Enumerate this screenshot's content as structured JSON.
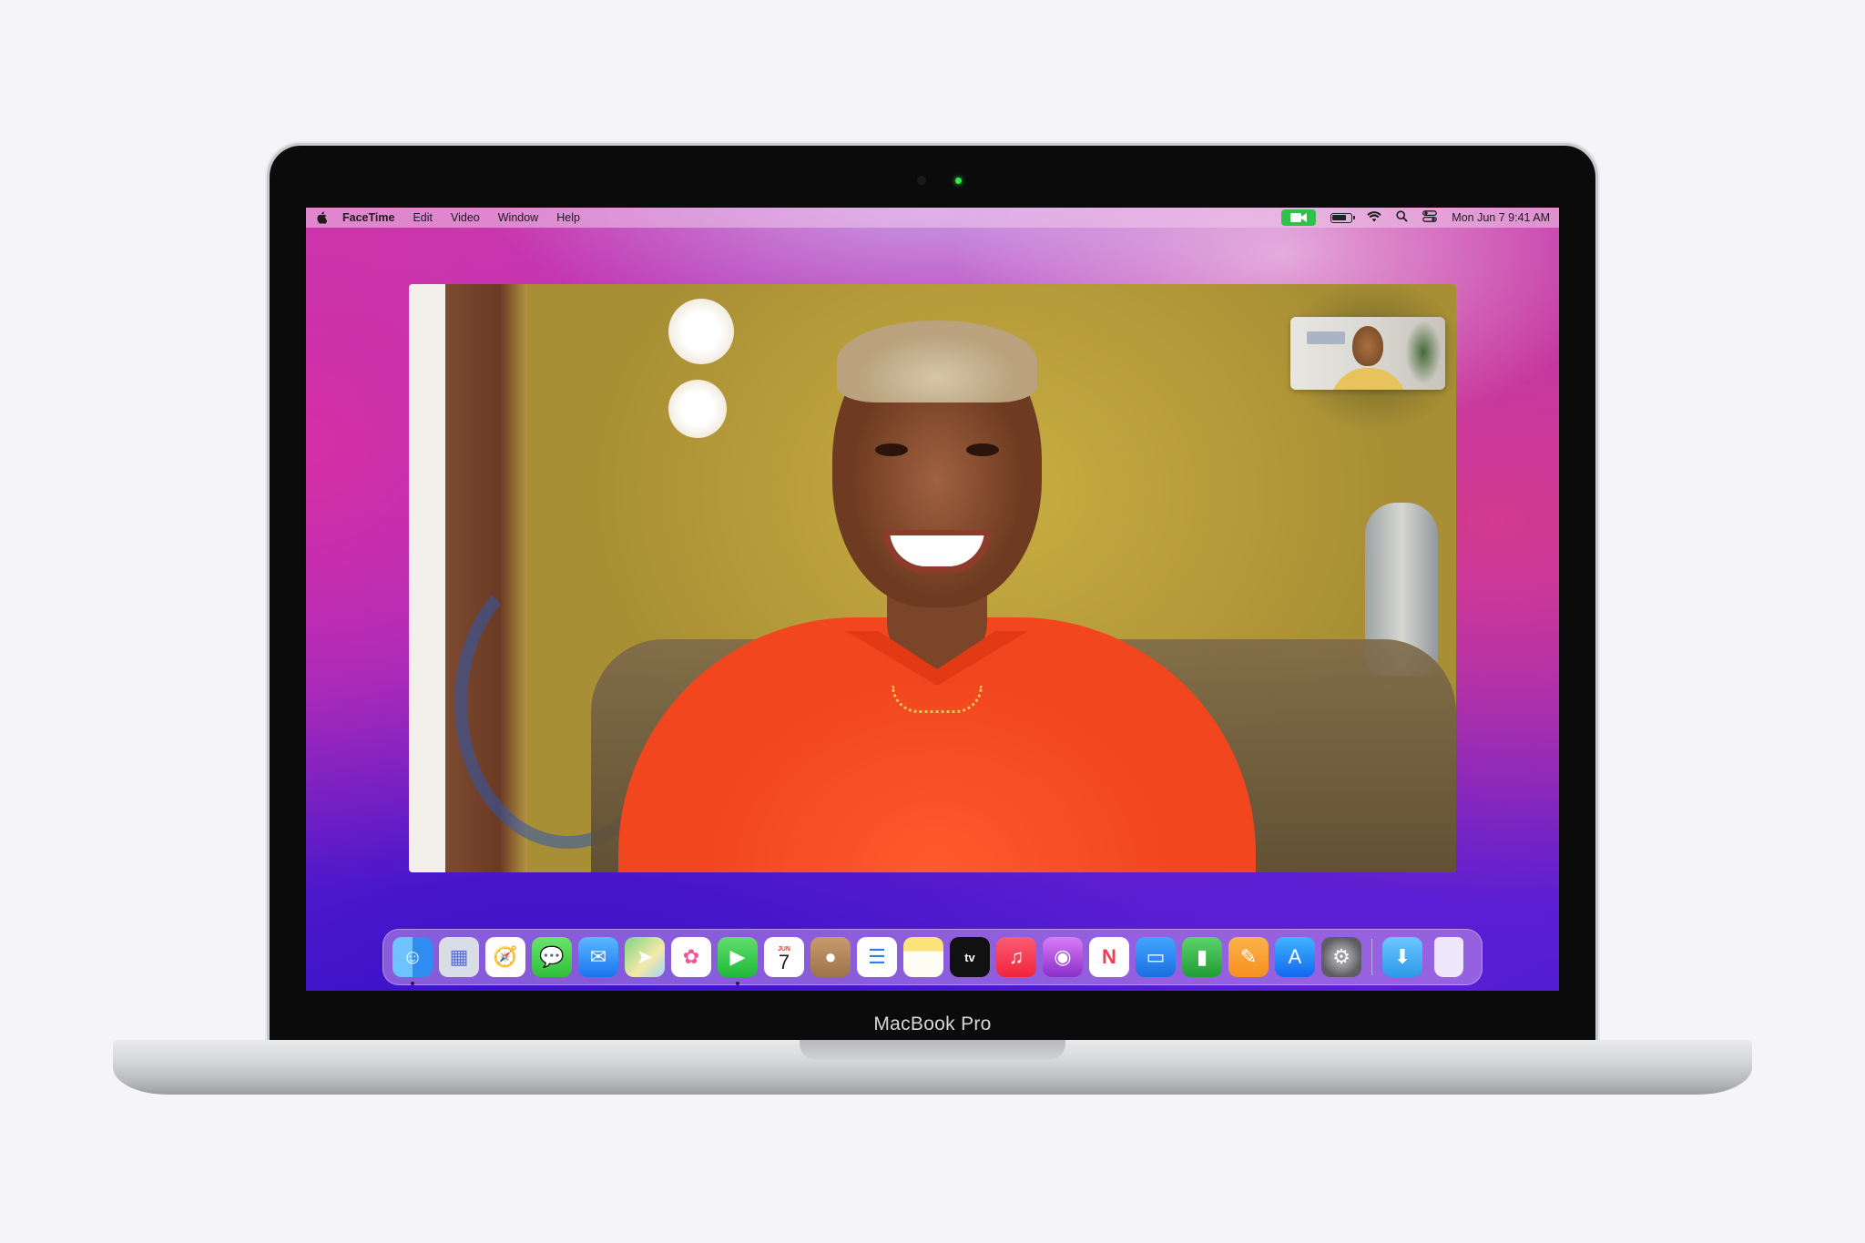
{
  "menubar": {
    "app_name": "FaceTime",
    "items": [
      "Edit",
      "Video",
      "Window",
      "Help"
    ],
    "clock": "Mon Jun 7  9:41 AM",
    "battery_level": 0.8
  },
  "facetime": {
    "main_video": "remote-participant-video",
    "self_view": "self-view-video"
  },
  "dock": {
    "apps": [
      {
        "name": "finder",
        "glyph": "☺",
        "running": true
      },
      {
        "name": "launchpad",
        "glyph": "▦",
        "running": false
      },
      {
        "name": "safari",
        "glyph": "🧭",
        "running": false
      },
      {
        "name": "messages",
        "glyph": "💬",
        "running": false
      },
      {
        "name": "mail",
        "glyph": "✉",
        "running": false
      },
      {
        "name": "maps",
        "glyph": "➤",
        "running": false
      },
      {
        "name": "photos",
        "glyph": "✿",
        "running": false
      },
      {
        "name": "facetime",
        "glyph": "▶",
        "running": true
      },
      {
        "name": "calendar",
        "month": "JUN",
        "day": "7",
        "running": false
      },
      {
        "name": "contacts",
        "glyph": "●",
        "running": false
      },
      {
        "name": "reminders",
        "glyph": "☰",
        "running": false
      },
      {
        "name": "notes",
        "glyph": "",
        "running": false
      },
      {
        "name": "tv",
        "glyph": "tv",
        "running": false
      },
      {
        "name": "music",
        "glyph": "♫",
        "running": false
      },
      {
        "name": "podcasts",
        "glyph": "◉",
        "running": false
      },
      {
        "name": "news",
        "glyph": "N",
        "running": false
      },
      {
        "name": "keynote",
        "glyph": "▭",
        "running": false
      },
      {
        "name": "numbers",
        "glyph": "▮",
        "running": false
      },
      {
        "name": "pages",
        "glyph": "✎",
        "running": false
      },
      {
        "name": "app-store",
        "glyph": "A",
        "running": false
      },
      {
        "name": "system-preferences",
        "glyph": "⚙",
        "running": false
      }
    ],
    "trailing": [
      {
        "name": "downloads",
        "glyph": "⬇"
      },
      {
        "name": "trash",
        "glyph": ""
      }
    ]
  },
  "device": {
    "label": "MacBook Pro"
  },
  "colors": {
    "facetime_green": "#2fc24a",
    "camera_led": "#32e64b",
    "shirt": "#f2461f"
  }
}
